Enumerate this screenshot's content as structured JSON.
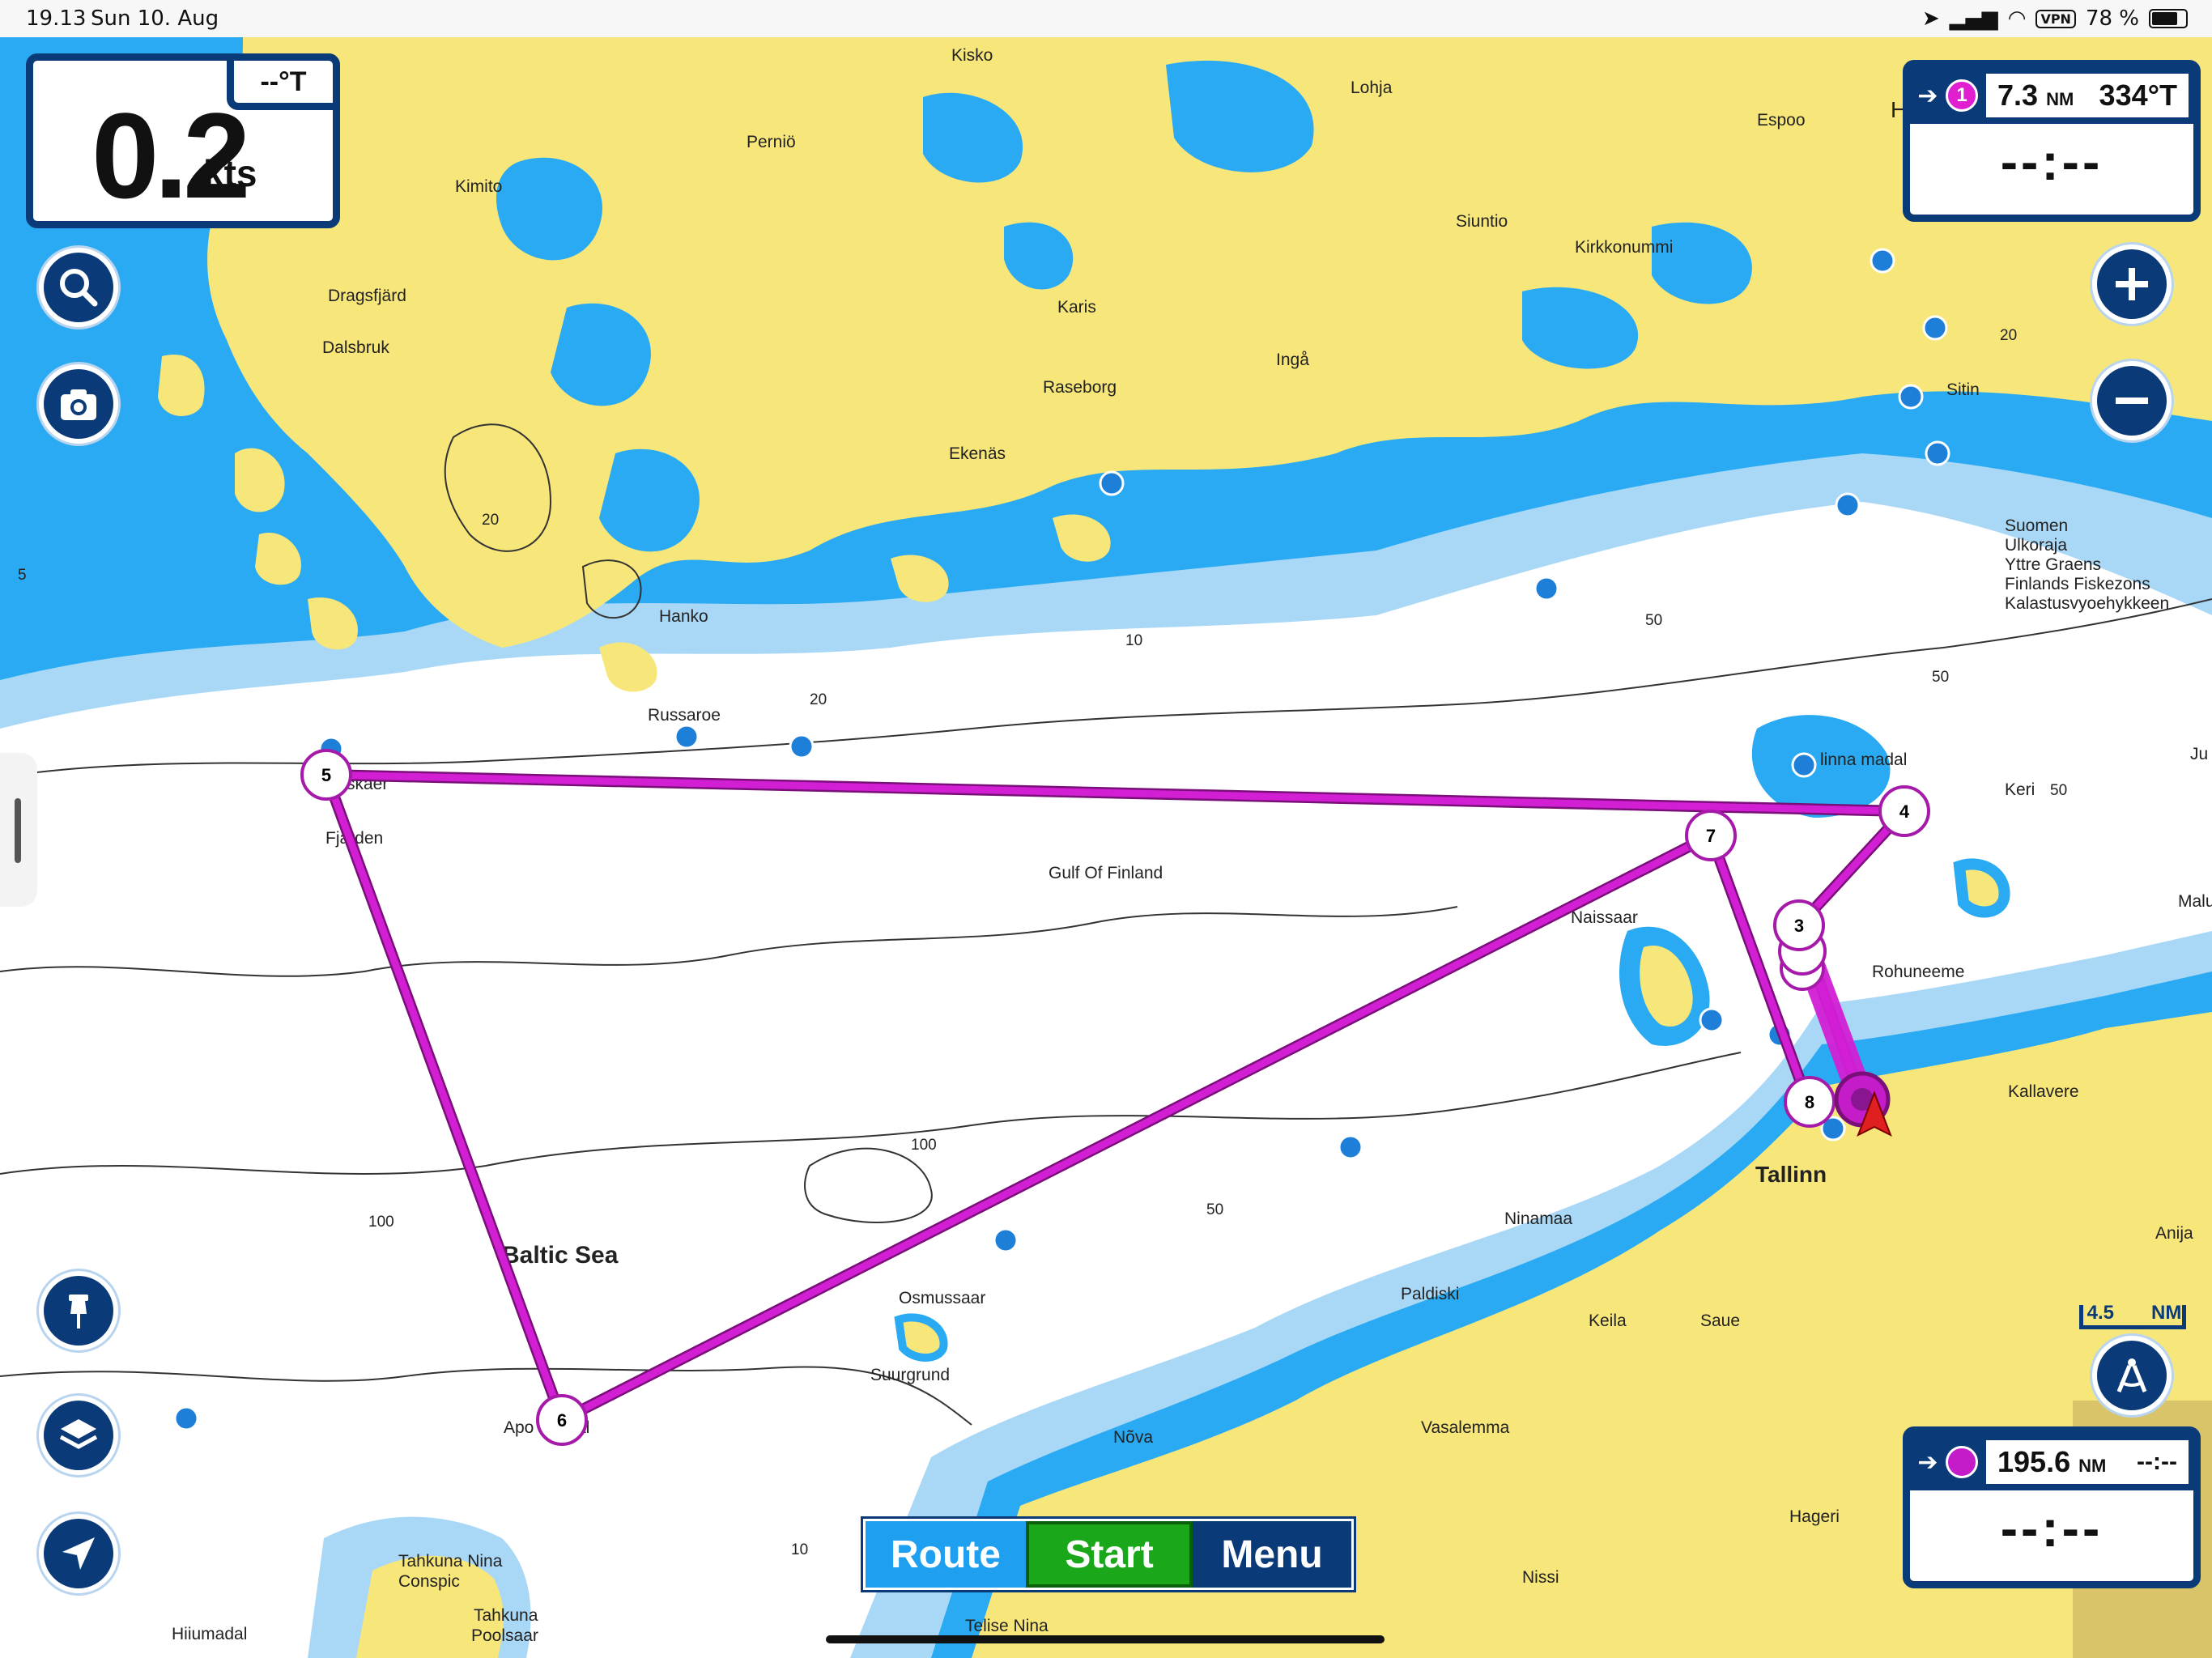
{
  "status_bar": {
    "time": "19.13",
    "date": "Sun 10. Aug",
    "vpn": "VPN",
    "battery": "78 %",
    "battery_level": 0.78
  },
  "speed_panel": {
    "value": "0.2",
    "unit": "kts",
    "heading": "--°T"
  },
  "waypoint_panel": {
    "badge": "1",
    "distance": "7.3",
    "distance_unit": "NM",
    "bearing": "334°T",
    "eta": "--:--"
  },
  "destination_panel": {
    "distance": "195.6",
    "distance_unit": "NM",
    "time": "--:--",
    "eta": "--:--"
  },
  "toolbar": {
    "route_label": "Route",
    "start_label": "Start",
    "menu_label": "Menu"
  },
  "scale": {
    "value": "4.5",
    "unit": "NM"
  },
  "map": {
    "place_names": {
      "kisko": "Kisko",
      "lohja": "Lohja",
      "espoo": "Espoo",
      "pernio": "Perniö",
      "kimito": "Kimito",
      "siuntio": "Siuntio",
      "kirkkonummi": "Kirkkonummi",
      "dragsfjard": "Dragsfjärd",
      "karis": "Karis",
      "dalsbruk": "Dalsbruk",
      "inga": "Ingå",
      "raseborg": "Raseborg",
      "sitin": "Sitin",
      "ekenas": "Ekenäs",
      "hanko": "Hanko",
      "russaroe": "Russaroe",
      "fjarden": "Fjärden",
      "skaer": "skaer",
      "gulf": "Gulf Of Finland",
      "naissaar": "Naissaar",
      "rohuneeme": "Rohuneeme",
      "kallavere": "Kallavere",
      "tallinn": "Tallinn",
      "ninamaa": "Ninamaa",
      "paldiski": "Paldiski",
      "keila": "Keila",
      "saue": "Saue",
      "baltic": "Baltic Sea",
      "osmussaar": "Osmussaar",
      "suurgrund": "Suurgrund",
      "apoy": "Apo",
      "al": "al",
      "nova": "Nõva",
      "vasalemma": "Vasalemma",
      "hagcri": "Hageri",
      "nissi": "Nissi",
      "anija": "Anija",
      "keri": "Keri",
      "ju": "Ju",
      "malu": "Malu",
      "linna_madal": "linna madal",
      "tahkuna_nina": "Tahkuna Nina",
      "conspic": "Conspic",
      "tahkuna_poolsaar": "Tahkuna\nPoolsaar",
      "tahkuna": "Tahkuna",
      "poolsaar": "Poolsaar",
      "hiiumadal": "Hiiumadal",
      "telise_nina": "Telise Nina",
      "h": "H",
      "fisk1": "Suomen",
      "fisk2": "Ulkoraja",
      "fisk3": "Yttre Graens",
      "fisk4": "Finlands Fiskezons",
      "fisk5": "Kalastusvyoehykkeen"
    },
    "depths": {
      "d20a": "20",
      "d5": "5",
      "d10a": "10",
      "d20b": "20",
      "d50a": "50",
      "d50b": "50",
      "d20c": "20",
      "d50c": "50",
      "d100a": "100",
      "d100b": "100",
      "d50d": "50",
      "d10b": "10"
    },
    "route_waypoints": [
      {
        "label": "3"
      },
      {
        "label": "4"
      },
      {
        "label": "5"
      },
      {
        "label": "6"
      },
      {
        "label": "7"
      },
      {
        "label": "8"
      }
    ],
    "colors": {
      "land": "#f7e67a",
      "deep_water": "#ffffff",
      "shallow_water": "#29aaf2",
      "mid_water": "#a9d8f7",
      "route": "#d21fd4",
      "ui_blue": "#0b3a78",
      "start_green": "#1aa81a"
    }
  }
}
